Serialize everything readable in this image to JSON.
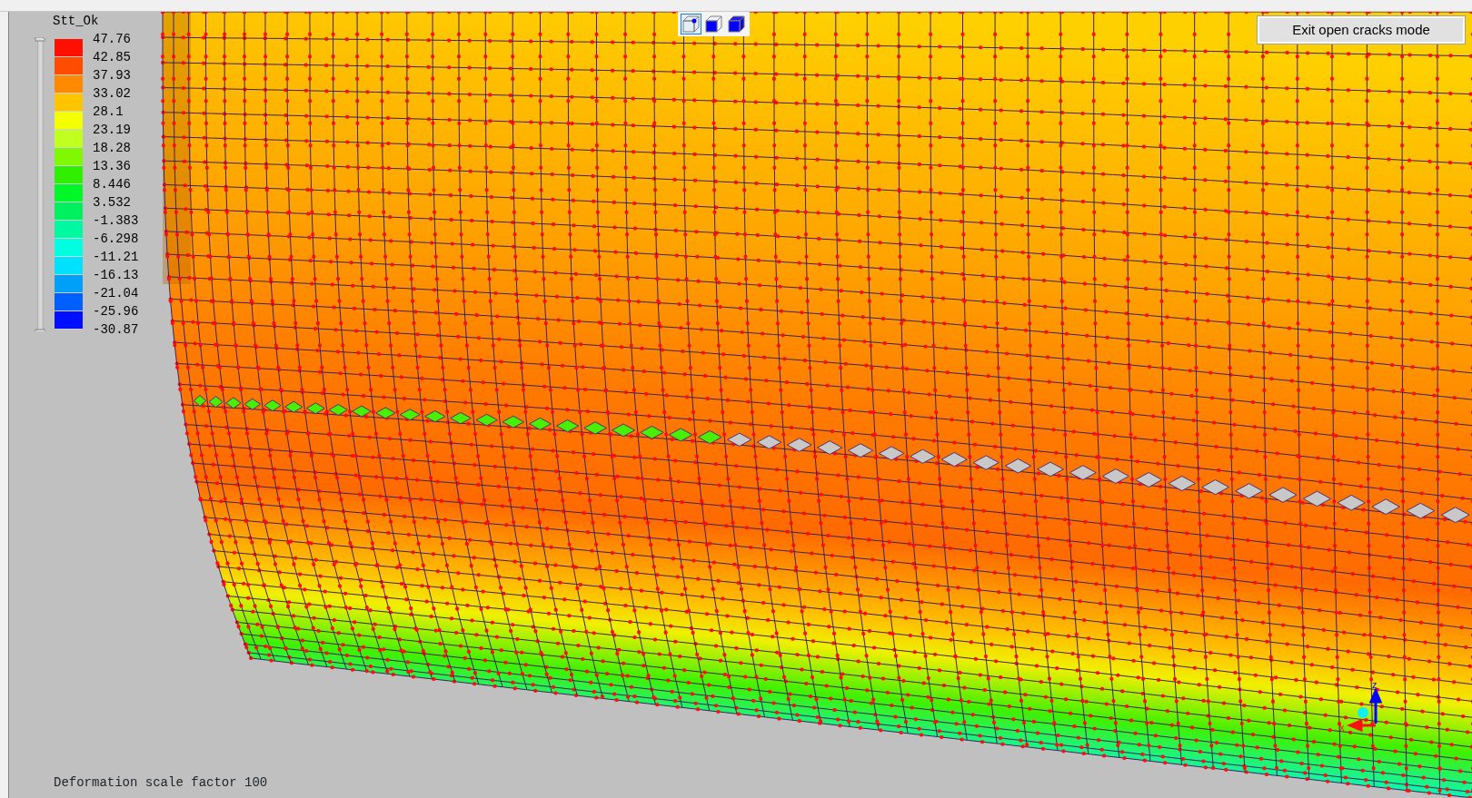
{
  "legend": {
    "title": "Stt_Ok",
    "bands": [
      {
        "color": "#ff1000"
      },
      {
        "color": "#ff4c00"
      },
      {
        "color": "#ff8a00"
      },
      {
        "color": "#ffc400"
      },
      {
        "color": "#f4ff00"
      },
      {
        "color": "#c0ff20"
      },
      {
        "color": "#80f800"
      },
      {
        "color": "#30f000"
      },
      {
        "color": "#00f828"
      },
      {
        "color": "#00f060"
      },
      {
        "color": "#00f8a0"
      },
      {
        "color": "#00ffe0"
      },
      {
        "color": "#00e0ff"
      },
      {
        "color": "#00a0f8"
      },
      {
        "color": "#0060ff"
      },
      {
        "color": "#0010ff"
      }
    ],
    "slider": {
      "level": 1
    },
    "labels": [
      "47.76",
      "42.85",
      "37.93",
      "33.02",
      "28.1",
      "23.19",
      "18.28",
      "13.36",
      "8.446",
      "3.532",
      "-1.383",
      "-6.298",
      "-11.21",
      "-16.13",
      "-21.04",
      "-25.96",
      "-30.87"
    ]
  },
  "view_toolbar": [
    {
      "kind": "wireframe",
      "selected": true
    },
    {
      "kind": "outline",
      "selected": false
    },
    {
      "kind": "solid",
      "selected": false
    }
  ],
  "exit_button": {
    "label": "Exit open cracks mode"
  },
  "axis_triad": {
    "labels": [
      "z",
      "x"
    ]
  },
  "status_text": "Deformation scale factor 100"
}
